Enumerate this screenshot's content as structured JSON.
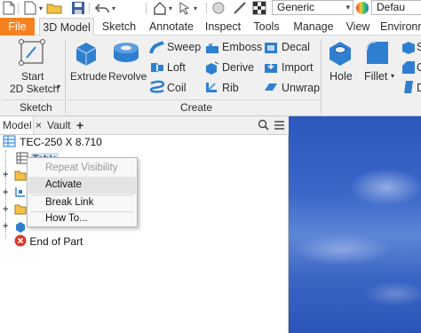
{
  "quick_access": {
    "appearance_value": "Generic",
    "material_value": "Defau"
  },
  "ribbon": {
    "tabs": [
      {
        "label": "File"
      },
      {
        "label": "3D Model"
      },
      {
        "label": "Sketch"
      },
      {
        "label": "Annotate"
      },
      {
        "label": "Inspect"
      },
      {
        "label": "Tools"
      },
      {
        "label": "Manage"
      },
      {
        "label": "View"
      },
      {
        "label": "Environn"
      }
    ],
    "sketch_panel": {
      "start_sketch_line1": "Start",
      "start_sketch_line2": "2D Sketch",
      "title": "Sketch"
    },
    "create_panel": {
      "extrude": "Extrude",
      "revolve": "Revolve",
      "sweep": "Sweep",
      "loft": "Loft",
      "coil": "Coil",
      "emboss": "Emboss",
      "derive": "Derive",
      "rib": "Rib",
      "decal": "Decal",
      "import": "Import",
      "unwrap": "Unwrap",
      "title": "Create"
    },
    "modify_panel": {
      "hole": "Hole",
      "fillet": "Fillet",
      "s_item": "S",
      "c_item": "C",
      "d_item": "D"
    }
  },
  "browser": {
    "tabs": [
      {
        "label": "Model"
      },
      {
        "label": "Vault"
      }
    ],
    "add_tab_glyph": "+",
    "tree": {
      "root": "TEC-250 X 8.710",
      "table_item": "Table",
      "end_of_part": "End of Part"
    }
  },
  "context_menu": {
    "items": [
      {
        "label": "Repeat Visibility",
        "disabled": true
      },
      {
        "label": "Activate",
        "disabled": false
      },
      {
        "label": "Break Link",
        "disabled": false
      },
      {
        "label": "How To...",
        "disabled": false
      }
    ]
  },
  "colors": {
    "file_tab": "#f58220",
    "ribbon_bg": "#f0f0f0",
    "icon_blue": "#2f7fd1",
    "viewport_blue": "#3a66c8"
  }
}
